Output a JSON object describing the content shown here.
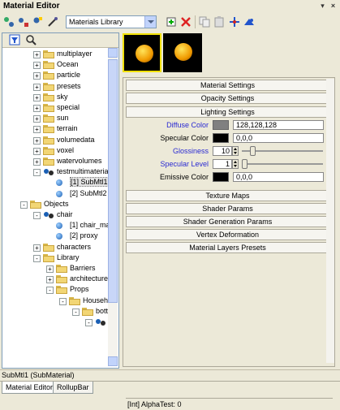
{
  "window": {
    "title": "Material Editor"
  },
  "toolbar": {
    "library_combo": "Materials Library"
  },
  "tree": {
    "items": [
      {
        "label": "multiplayer",
        "kind": "folder",
        "exp": "+",
        "indent": 1
      },
      {
        "label": "Ocean",
        "kind": "folder",
        "exp": "+",
        "indent": 1
      },
      {
        "label": "particle",
        "kind": "folder",
        "exp": "+",
        "indent": 1
      },
      {
        "label": "presets",
        "kind": "folder",
        "exp": "+",
        "indent": 1
      },
      {
        "label": "sky",
        "kind": "folder",
        "exp": "+",
        "indent": 1
      },
      {
        "label": "special",
        "kind": "folder",
        "exp": "+",
        "indent": 1
      },
      {
        "label": "sun",
        "kind": "folder",
        "exp": "+",
        "indent": 1
      },
      {
        "label": "terrain",
        "kind": "folder",
        "exp": "+",
        "indent": 1
      },
      {
        "label": "volumedata",
        "kind": "folder",
        "exp": "+",
        "indent": 1
      },
      {
        "label": "voxel",
        "kind": "folder",
        "exp": "+",
        "indent": 1
      },
      {
        "label": "watervolumes",
        "kind": "folder",
        "exp": "+",
        "indent": 1
      },
      {
        "label": "testmultimaterial",
        "kind": "material",
        "exp": "-",
        "indent": 1
      },
      {
        "label": "[1] SubMtl1",
        "kind": "sphere",
        "exp": "",
        "indent": 2,
        "selected": true
      },
      {
        "label": "[2] SubMtl2",
        "kind": "sphere",
        "exp": "",
        "indent": 2
      },
      {
        "label": "Objects",
        "kind": "folder",
        "exp": "-",
        "indent": 0
      },
      {
        "label": "chair",
        "kind": "material",
        "exp": "-",
        "indent": 1
      },
      {
        "label": "[1] chair_mat",
        "kind": "sphere",
        "exp": "",
        "indent": 2
      },
      {
        "label": "[2] proxy",
        "kind": "sphere",
        "exp": "",
        "indent": 2
      },
      {
        "label": "characters",
        "kind": "folder",
        "exp": "+",
        "indent": 1
      },
      {
        "label": "Library",
        "kind": "folder",
        "exp": "-",
        "indent": 1
      },
      {
        "label": "Barriers",
        "kind": "folder",
        "exp": "+",
        "indent": 2
      },
      {
        "label": "architecture",
        "kind": "folder",
        "exp": "+",
        "indent": 2
      },
      {
        "label": "Props",
        "kind": "folder",
        "exp": "-",
        "indent": 2
      },
      {
        "label": "Househol",
        "kind": "folder",
        "exp": "-",
        "indent": 3
      },
      {
        "label": "bottl",
        "kind": "folder",
        "exp": "-",
        "indent": 4
      },
      {
        "label": "",
        "kind": "material",
        "exp": "-",
        "indent": 5
      }
    ]
  },
  "rollups": {
    "material_settings": "Material Settings",
    "opacity_settings": "Opacity Settings",
    "lighting_settings": "Lighting Settings",
    "texture_maps": "Texture Maps",
    "shader_params": "Shader Params",
    "shader_generation_params": "Shader Generation Params",
    "vertex_deformation": "Vertex Deformation",
    "material_layers_presets": "Material Layers Presets"
  },
  "lighting": {
    "diffuse_label": "Diffuse Color",
    "diffuse_value": "128,128,128",
    "diffuse_swatch": "#808080",
    "specular_label": "Specular Color",
    "specular_value": "0,0,0",
    "specular_swatch": "#000000",
    "glossiness_label": "Glossiness",
    "glossiness_value": "10",
    "glossiness_fraction": 0.1,
    "specular_level_label": "Specular Level",
    "specular_level_value": "1",
    "specular_level_fraction": 0.0,
    "emissive_label": "Emissive Color",
    "emissive_value": "0,0,0",
    "emissive_swatch": "#000000"
  },
  "panel_status": "[Int] AlphaTest: 0",
  "status": {
    "text": "SubMtl1 (SubMaterial)"
  },
  "tabs": [
    {
      "label": "Material Editor",
      "active": true
    },
    {
      "label": "RollupBar",
      "active": false
    }
  ],
  "colors": {
    "highlight_label": "#2A2AD2",
    "preview_selected_border": "#F0E000"
  }
}
